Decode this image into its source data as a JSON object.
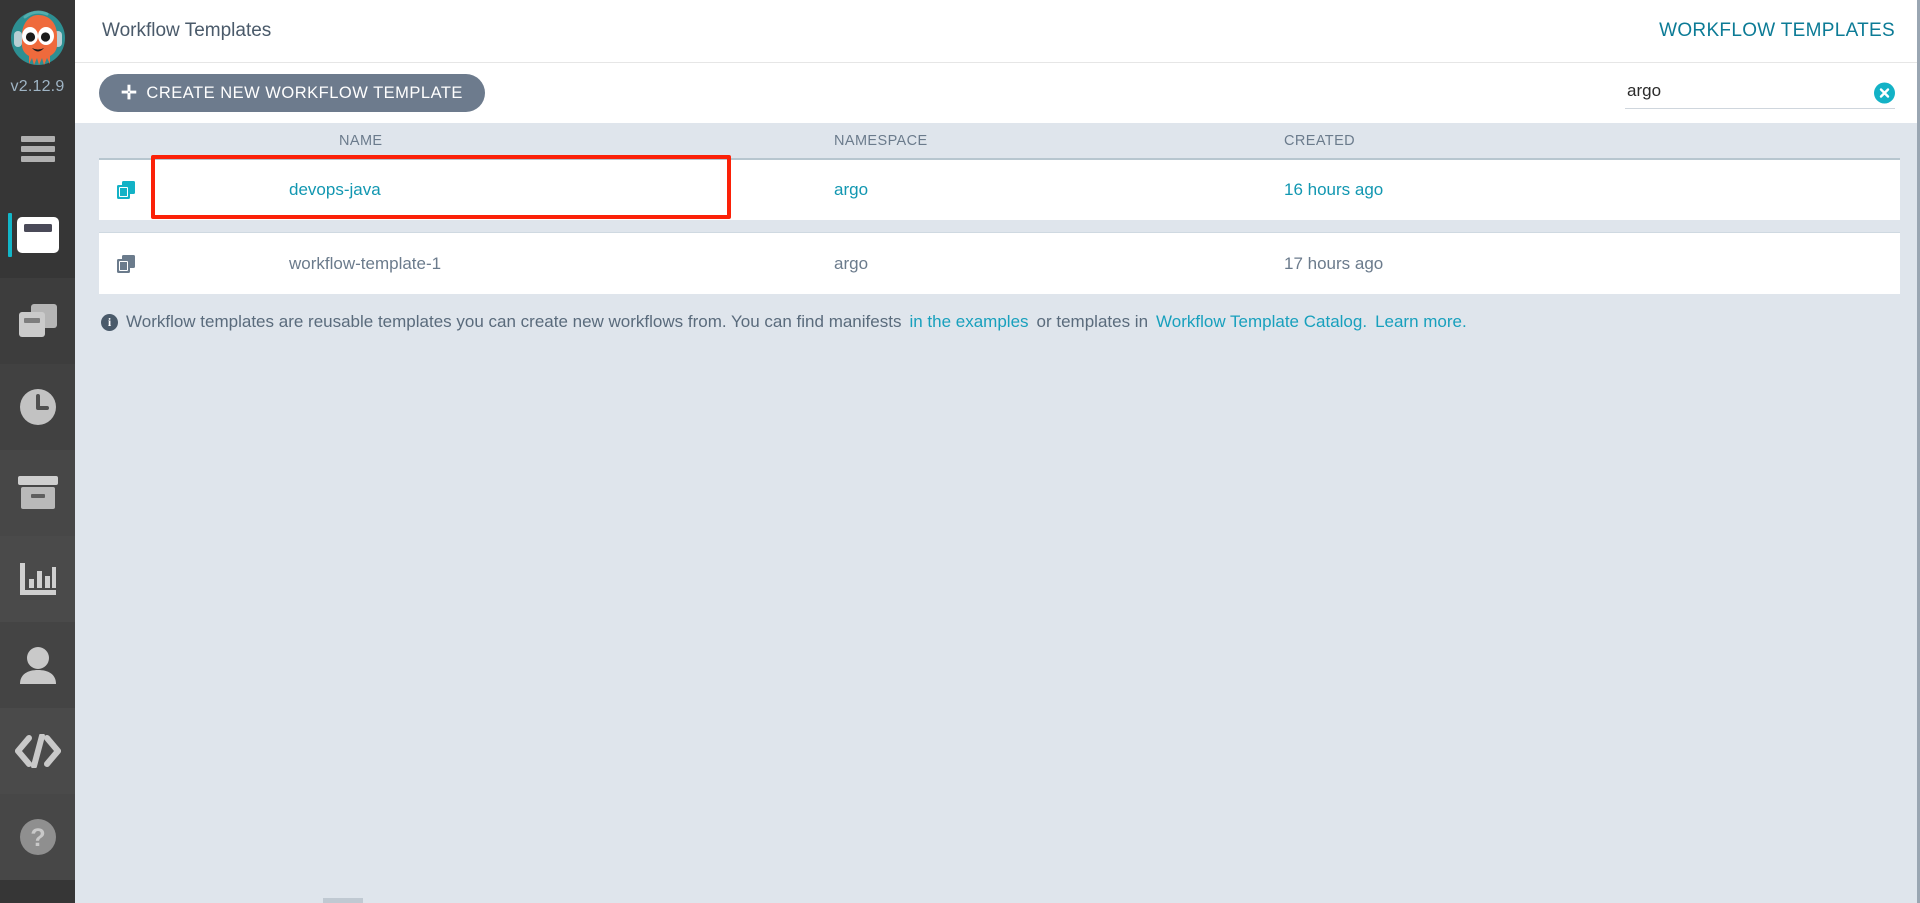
{
  "sidebar": {
    "version": "v2.12.9",
    "logo_alt": "argo-octopus-logo",
    "items": [
      {
        "id": "menu",
        "icon": "hamburger-menu-icon",
        "label": "Menu"
      },
      {
        "id": "workflows",
        "icon": "window-icon",
        "label": "Workflows"
      },
      {
        "id": "workflow-templates",
        "icon": "copy-stack-icon",
        "label": "Workflow Templates"
      },
      {
        "id": "cron-workflows",
        "icon": "clock-icon",
        "label": "Cron Workflows"
      },
      {
        "id": "archived",
        "icon": "archive-box-icon",
        "label": "Archived Workflows"
      },
      {
        "id": "reports",
        "icon": "bar-chart-icon",
        "label": "Reports"
      },
      {
        "id": "user",
        "icon": "user-icon",
        "label": "User"
      },
      {
        "id": "api-docs",
        "icon": "code-brackets-icon",
        "label": "API Docs"
      },
      {
        "id": "help",
        "icon": "question-mark-icon",
        "label": "Help"
      }
    ]
  },
  "topbar": {
    "title": "Workflow Templates",
    "right_label": "WORKFLOW TEMPLATES"
  },
  "toolbar": {
    "create_label": "CREATE NEW WORKFLOW TEMPLATE",
    "create_plus": "✛",
    "search_value": "argo",
    "search_placeholder": "",
    "clear_icon": "close-circle-icon"
  },
  "table": {
    "columns": [
      "NAME",
      "NAMESPACE",
      "CREATED"
    ],
    "rows": [
      {
        "name": "devops-java",
        "namespace": "argo",
        "created": "16 hours ago",
        "icon": "copy-stack-icon",
        "state": "hovered"
      },
      {
        "name": "workflow-template-1",
        "namespace": "argo",
        "created": "17 hours ago",
        "icon": "copy-stack-icon",
        "state": "normal"
      }
    ]
  },
  "info": {
    "icon": "info-icon",
    "text_1": "Workflow templates are reusable templates you can create new workflows from. You can find manifests",
    "link_1": "in the examples",
    "text_2": "or templates in",
    "link_2": "Workflow Template Catalog.",
    "link_3": "Learn more."
  },
  "colors": {
    "accent_teal": "#13b2c6",
    "link_teal": "#18a0bd",
    "sidebar_bg": "#363636",
    "page_bg": "#dfe5ec",
    "button_gray": "#6d7b8d",
    "selection_red": "#fb2108",
    "header_blue": "#0c7b96"
  }
}
